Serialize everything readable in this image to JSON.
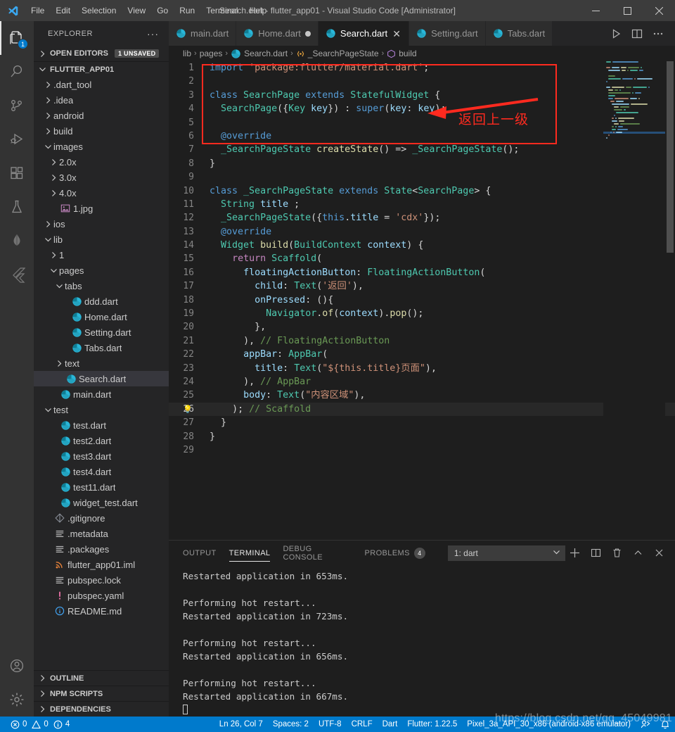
{
  "window": {
    "title": "Search.dart - flutter_app01 - Visual Studio Code [Administrator]",
    "minimize": "−",
    "maximize": "□",
    "close": "✕"
  },
  "menubar": {
    "items": [
      "File",
      "Edit",
      "Selection",
      "View",
      "Go",
      "Run",
      "Terminal",
      "Help"
    ]
  },
  "activitybar": {
    "items": [
      {
        "name": "explorer",
        "icon": "files-icon",
        "badge": "1",
        "active": true
      },
      {
        "name": "search",
        "icon": "search-icon",
        "badge": "",
        "active": false
      },
      {
        "name": "source-control",
        "icon": "source-control-icon",
        "badge": "",
        "active": false
      },
      {
        "name": "run-and-debug",
        "icon": "debug-icon",
        "badge": "",
        "active": false
      },
      {
        "name": "extensions",
        "icon": "extensions-icon",
        "badge": "",
        "active": false
      },
      {
        "name": "testing",
        "icon": "beaker-icon",
        "badge": "",
        "active": false
      },
      {
        "name": "mongodb",
        "icon": "leaf-icon",
        "badge": "",
        "active": false
      },
      {
        "name": "flutter",
        "icon": "flutter-icon",
        "badge": "",
        "active": false
      }
    ],
    "bottom": [
      {
        "name": "accounts",
        "icon": "account-icon"
      },
      {
        "name": "settings",
        "icon": "gear-icon"
      }
    ]
  },
  "sidebar": {
    "title": "EXPLORER",
    "more_label": "···",
    "open_editors": {
      "label": "OPEN EDITORS",
      "badge": "1 UNSAVED",
      "expanded": false
    },
    "project": {
      "label": "FLUTTER_APP01",
      "expanded": true
    },
    "tree": [
      {
        "label": ".dart_tool",
        "depth": 1,
        "type": "folder",
        "expanded": false,
        "selected": false
      },
      {
        "label": ".idea",
        "depth": 1,
        "type": "folder",
        "expanded": false,
        "selected": false
      },
      {
        "label": "android",
        "depth": 1,
        "type": "folder",
        "expanded": false,
        "selected": false
      },
      {
        "label": "build",
        "depth": 1,
        "type": "folder",
        "expanded": false,
        "selected": false
      },
      {
        "label": "images",
        "depth": 1,
        "type": "folder",
        "expanded": true,
        "selected": false
      },
      {
        "label": "2.0x",
        "depth": 2,
        "type": "folder",
        "expanded": false,
        "selected": false
      },
      {
        "label": "3.0x",
        "depth": 2,
        "type": "folder",
        "expanded": false,
        "selected": false
      },
      {
        "label": "4.0x",
        "depth": 2,
        "type": "folder",
        "expanded": false,
        "selected": false
      },
      {
        "label": "1.jpg",
        "depth": 2,
        "type": "image",
        "expanded": false,
        "selected": false
      },
      {
        "label": "ios",
        "depth": 1,
        "type": "folder",
        "expanded": false,
        "selected": false
      },
      {
        "label": "lib",
        "depth": 1,
        "type": "folder",
        "expanded": true,
        "selected": false
      },
      {
        "label": "1",
        "depth": 2,
        "type": "folder",
        "expanded": false,
        "selected": false
      },
      {
        "label": "pages",
        "depth": 2,
        "type": "folder",
        "expanded": true,
        "selected": false
      },
      {
        "label": "tabs",
        "depth": 3,
        "type": "folder",
        "expanded": true,
        "selected": false
      },
      {
        "label": "ddd.dart",
        "depth": 4,
        "type": "dart",
        "expanded": false,
        "selected": false
      },
      {
        "label": "Home.dart",
        "depth": 4,
        "type": "dart",
        "expanded": false,
        "selected": false
      },
      {
        "label": "Setting.dart",
        "depth": 4,
        "type": "dart",
        "expanded": false,
        "selected": false
      },
      {
        "label": "Tabs.dart",
        "depth": 4,
        "type": "dart",
        "expanded": false,
        "selected": false
      },
      {
        "label": "text",
        "depth": 3,
        "type": "folder",
        "expanded": false,
        "selected": false
      },
      {
        "label": "Search.dart",
        "depth": 3,
        "type": "dart",
        "expanded": false,
        "selected": true
      },
      {
        "label": "main.dart",
        "depth": 2,
        "type": "dart",
        "expanded": false,
        "selected": false
      },
      {
        "label": "test",
        "depth": 1,
        "type": "folder",
        "expanded": true,
        "selected": false
      },
      {
        "label": "test.dart",
        "depth": 2,
        "type": "dart",
        "expanded": false,
        "selected": false
      },
      {
        "label": "test2.dart",
        "depth": 2,
        "type": "dart",
        "expanded": false,
        "selected": false
      },
      {
        "label": "test3.dart",
        "depth": 2,
        "type": "dart",
        "expanded": false,
        "selected": false
      },
      {
        "label": "test4.dart",
        "depth": 2,
        "type": "dart",
        "expanded": false,
        "selected": false
      },
      {
        "label": "test11.dart",
        "depth": 2,
        "type": "dart",
        "expanded": false,
        "selected": false
      },
      {
        "label": "widget_test.dart",
        "depth": 2,
        "type": "dart",
        "expanded": false,
        "selected": false
      },
      {
        "label": ".gitignore",
        "depth": 1,
        "type": "git",
        "expanded": false,
        "selected": false
      },
      {
        "label": ".metadata",
        "depth": 1,
        "type": "config",
        "expanded": false,
        "selected": false
      },
      {
        "label": ".packages",
        "depth": 1,
        "type": "config",
        "expanded": false,
        "selected": false
      },
      {
        "label": "flutter_app01.iml",
        "depth": 1,
        "type": "iml",
        "expanded": false,
        "selected": false
      },
      {
        "label": "pubspec.lock",
        "depth": 1,
        "type": "config",
        "expanded": false,
        "selected": false
      },
      {
        "label": "pubspec.yaml",
        "depth": 1,
        "type": "yaml",
        "expanded": false,
        "selected": false
      },
      {
        "label": "README.md",
        "depth": 1,
        "type": "info",
        "expanded": false,
        "selected": false
      }
    ],
    "bottom_sections": [
      {
        "label": "OUTLINE"
      },
      {
        "label": "NPM SCRIPTS"
      },
      {
        "label": "DEPENDENCIES"
      }
    ]
  },
  "editor": {
    "tabs": [
      {
        "label": "main.dart",
        "active": false,
        "dirty": false
      },
      {
        "label": "Home.dart",
        "active": false,
        "dirty": true
      },
      {
        "label": "Search.dart",
        "active": true,
        "dirty": false
      },
      {
        "label": "Setting.dart",
        "active": false,
        "dirty": false
      },
      {
        "label": "Tabs.dart",
        "active": false,
        "dirty": false
      }
    ],
    "tab_actions": [
      {
        "name": "run-icon"
      },
      {
        "name": "split-editor-icon"
      },
      {
        "name": "more-actions-icon"
      }
    ],
    "breadcrumbs": [
      "lib",
      "pages",
      "Search.dart",
      "_SearchPageState",
      "build"
    ],
    "current_line": 26,
    "lines": [
      {
        "n": 1,
        "text": "import 'package:flutter/material.dart';"
      },
      {
        "n": 2,
        "text": ""
      },
      {
        "n": 3,
        "text": "class SearchPage extends StatefulWidget {"
      },
      {
        "n": 4,
        "text": "  SearchPage({Key key}) : super(key: key);"
      },
      {
        "n": 5,
        "text": ""
      },
      {
        "n": 6,
        "text": "  @override"
      },
      {
        "n": 7,
        "text": "  _SearchPageState createState() => _SearchPageState();"
      },
      {
        "n": 8,
        "text": "}"
      },
      {
        "n": 9,
        "text": ""
      },
      {
        "n": 10,
        "text": "class _SearchPageState extends State<SearchPage> {"
      },
      {
        "n": 11,
        "text": "  String title ;"
      },
      {
        "n": 12,
        "text": "  _SearchPageState({this.title = 'cdx'});"
      },
      {
        "n": 13,
        "text": "  @override"
      },
      {
        "n": 14,
        "text": "  Widget build(BuildContext context) {"
      },
      {
        "n": 15,
        "text": "    return Scaffold("
      },
      {
        "n": 16,
        "text": "      floatingActionButton: FloatingActionButton("
      },
      {
        "n": 17,
        "text": "        child: Text('返回'),"
      },
      {
        "n": 18,
        "text": "        onPressed: (){"
      },
      {
        "n": 19,
        "text": "          Navigator.of(context).pop();"
      },
      {
        "n": 20,
        "text": "        },"
      },
      {
        "n": 21,
        "text": "      ), // FloatingActionButton"
      },
      {
        "n": 22,
        "text": "      appBar: AppBar("
      },
      {
        "n": 23,
        "text": "        title: Text(\"${this.title}页面\"),"
      },
      {
        "n": 24,
        "text": "      ), // AppBar"
      },
      {
        "n": 25,
        "text": "      body: Text(\"内容区域\"),"
      },
      {
        "n": 26,
        "text": "    ); // Scaffold"
      },
      {
        "n": 27,
        "text": "  }"
      },
      {
        "n": 28,
        "text": "}"
      },
      {
        "n": 29,
        "text": ""
      }
    ],
    "annotation": {
      "text": "返回上一级",
      "color": "#ff2a1f"
    }
  },
  "panel": {
    "tabs": [
      {
        "label": "OUTPUT",
        "active": false,
        "count": ""
      },
      {
        "label": "TERMINAL",
        "active": true,
        "count": ""
      },
      {
        "label": "DEBUG CONSOLE",
        "active": false,
        "count": ""
      },
      {
        "label": "PROBLEMS",
        "active": false,
        "count": "4"
      }
    ],
    "terminal_select": "1: dart",
    "actions": [
      {
        "name": "new-terminal-icon",
        "glyph": "+"
      },
      {
        "name": "split-terminal-icon",
        "glyph": "▯"
      },
      {
        "name": "kill-terminal-icon",
        "glyph": "🗑"
      },
      {
        "name": "maximize-panel-icon",
        "glyph": "^"
      },
      {
        "name": "close-panel-icon",
        "glyph": "✕"
      }
    ],
    "terminal_output": [
      "Restarted application in 653ms.",
      "",
      "Performing hot restart...",
      "Restarted application in 723ms.",
      "",
      "Performing hot restart...",
      "Restarted application in 656ms.",
      "",
      "Performing hot restart...",
      "Restarted application in 667ms."
    ]
  },
  "statusbar": {
    "errors": "0",
    "warnings": "0",
    "infos": "4",
    "items": [
      "Ln 26, Col 7",
      "Spaces: 2",
      "UTF-8",
      "CRLF",
      "Dart",
      "Flutter: 1.22.5",
      "Pixel_3a_API_30_x86 (android-x86 emulator)"
    ],
    "right_icons": [
      {
        "name": "live-share-icon"
      },
      {
        "name": "bell-icon"
      }
    ]
  },
  "watermark": "https://blog.csdn.net/qq_45049981",
  "colors": {
    "accent": "#007acc",
    "titlebar": "#3c3c3c",
    "sidebar": "#252526",
    "editor": "#1e1e1e",
    "activitybar": "#333333",
    "annotation": "#ff2a1f"
  }
}
